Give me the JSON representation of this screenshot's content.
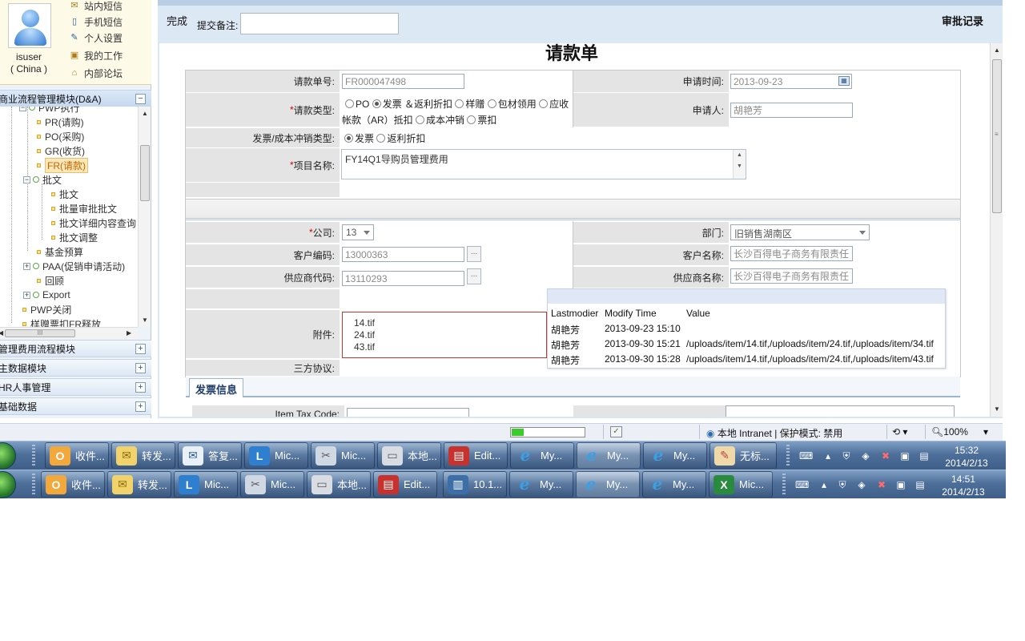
{
  "sidebar": {
    "user": {
      "name": "isuser",
      "region": "( China )"
    },
    "links": [
      {
        "label": "站内短信",
        "icon": "envelope-icon"
      },
      {
        "label": "手机短信",
        "icon": "mobile-phone-icon"
      },
      {
        "label": "个人设置",
        "icon": "edit-icon"
      },
      {
        "label": "我的工作",
        "icon": "briefcase-icon"
      },
      {
        "label": "内部论坛",
        "icon": "house-icon"
      }
    ],
    "active_module": "商业流程管理模块(D&A)",
    "tree": [
      "PWP执行",
      "PR(请购)",
      "PO(采购)",
      "GR(收货)",
      "FR(请款)",
      "批文",
      "批文",
      "批量审批批文",
      "批文详细内容查询",
      "批文调整",
      "基金预算",
      "PAA(促销申请活动)",
      "回顾",
      "Export",
      "PWP关闭",
      "样赠票扣FR释放"
    ],
    "tree_hscroll_label": "III",
    "modules": [
      "管理费用流程模块",
      "主数据模块",
      "HR人事管理",
      "基础数据"
    ]
  },
  "toolbar": {
    "done_label": "完成",
    "remark_label": "提交备注:",
    "remark_value": "",
    "audit_label": "审批记录"
  },
  "form": {
    "title": "请款单",
    "labels": {
      "request_no": "请款单号:",
      "request_time": "申请时间:",
      "request_type": "请款类型:",
      "applicant": "申请人:",
      "offset_type": "发票/成本冲销类型:",
      "project": "项目名称:",
      "company": "公司:",
      "department": "部门:",
      "customer_code": "客户编码:",
      "customer_name": "客户名称:",
      "supplier_code": "供应商代码:",
      "supplier_name": "供应商名称:",
      "attachment": "附件:",
      "tripartite": "三方协议:",
      "item_tax_code": "Item Tax Code:"
    },
    "required_mark": "*",
    "request_no": "FR000047498",
    "request_time": "2013-09-23",
    "applicant": "胡艳芳",
    "request_types": [
      {
        "label": "PO",
        "checked": false
      },
      {
        "label": "发票 ＆返利折扣",
        "checked": true
      },
      {
        "label": "样赠",
        "checked": false
      },
      {
        "label": "包材领用",
        "checked": false
      },
      {
        "label": "应收帐款（AR）抵扣",
        "checked": false
      },
      {
        "label": "成本冲销",
        "checked": false
      },
      {
        "label": "票扣",
        "checked": false
      }
    ],
    "offset_types": [
      {
        "label": "发票",
        "checked": true
      },
      {
        "label": "返利折扣",
        "checked": false
      }
    ],
    "project_name": "FY14Q1导购员管理费用",
    "company": "13",
    "department": "旧销售湖南区",
    "customer_code": "13000363",
    "customer_name": "长沙百得电子商务有限责任",
    "supplier_code": "13110293",
    "supplier_name": "长沙百得电子商务有限责任",
    "browse_btn": "...",
    "attachments": [
      "14.tif",
      "24.tif",
      "43.tif"
    ],
    "tab_invoice": "发票信息"
  },
  "tooltip": {
    "headers": [
      "Lastmodier",
      "Modify Time",
      "Value"
    ],
    "rows": [
      {
        "user": "胡艳芳",
        "time": "2013-09-23 15:10",
        "value": ""
      },
      {
        "user": "胡艳芳",
        "time": "2013-09-30 15:21",
        "value": "/uploads/item/14.tif,/uploads/item/24.tif,/uploads/item/34.tif"
      },
      {
        "user": "胡艳芳",
        "time": "2013-09-30 15:28",
        "value": "/uploads/item/14.tif,/uploads/item/24.tif,/uploads/item/43.tif"
      }
    ]
  },
  "statusbar": {
    "progress": 0.16,
    "zone": "本地 Intranet | 保护模式: 禁用",
    "zoom": "100%"
  },
  "taskbar_top": {
    "buttons": [
      "收件...",
      "转发...",
      "答复...",
      "Mic...",
      "Mic...",
      "本地...",
      "Edit...",
      "My...",
      "My...",
      "My...",
      "无标..."
    ],
    "time": "15:32",
    "date": "2014/2/13"
  },
  "taskbar_bottom": {
    "buttons": [
      "收件...",
      "转发...",
      "Mic...",
      "Mic...",
      "本地...",
      "Edit...",
      "10.1...",
      "My...",
      "My...",
      "My...",
      "Mic..."
    ],
    "time": "14:51",
    "date": "2014/2/13"
  },
  "colors": {
    "accent": "#dde8f5",
    "label_bg": "#e4e4e4",
    "required": "#d40000",
    "attachment_border": "#c0392b",
    "progress": "#3ccb2c"
  }
}
